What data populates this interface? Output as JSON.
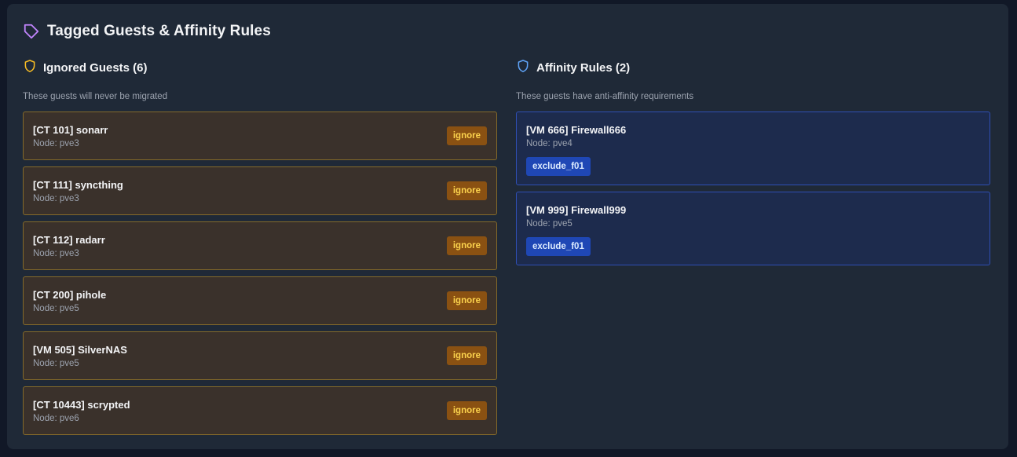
{
  "panel": {
    "title": "Tagged Guests & Affinity Rules",
    "title_icon": "tag-icon"
  },
  "ignored": {
    "title": "Ignored Guests (6)",
    "icon": "shield-icon",
    "description": "These guests will never be migrated",
    "guests": [
      {
        "name": "[CT 101] sonarr",
        "node": "Node: pve3",
        "tag": "ignore"
      },
      {
        "name": "[CT 111] syncthing",
        "node": "Node: pve3",
        "tag": "ignore"
      },
      {
        "name": "[CT 112] radarr",
        "node": "Node: pve3",
        "tag": "ignore"
      },
      {
        "name": "[CT 200] pihole",
        "node": "Node: pve5",
        "tag": "ignore"
      },
      {
        "name": "[VM 505] SilverNAS",
        "node": "Node: pve5",
        "tag": "ignore"
      },
      {
        "name": "[CT 10443] scrypted",
        "node": "Node: pve6",
        "tag": "ignore"
      }
    ]
  },
  "affinity": {
    "title": "Affinity Rules (2)",
    "icon": "shield-icon",
    "description": "These guests have anti-affinity requirements",
    "guests": [
      {
        "name": "[VM 666] Firewall666",
        "node": "Node: pve4",
        "tag": "exclude_f01"
      },
      {
        "name": "[VM 999] Firewall999",
        "node": "Node: pve5",
        "tag": "exclude_f01"
      }
    ]
  },
  "colors": {
    "page_bg": "#111827",
    "panel_bg": "#1f2937",
    "tag_icon": "#c084fc",
    "ignore_icon": "#fbbf24",
    "affinity_icon": "#60a5fa",
    "ignore_card_bg": "#3a312b",
    "ignore_card_border": "#846a2a",
    "ignore_badge_bg": "#8a5112",
    "ignore_badge_text": "#fcd34d",
    "affinity_card_bg": "#1d2b4d",
    "affinity_card_border": "#2f4fb4",
    "affinity_badge_bg": "#1f47b5"
  }
}
